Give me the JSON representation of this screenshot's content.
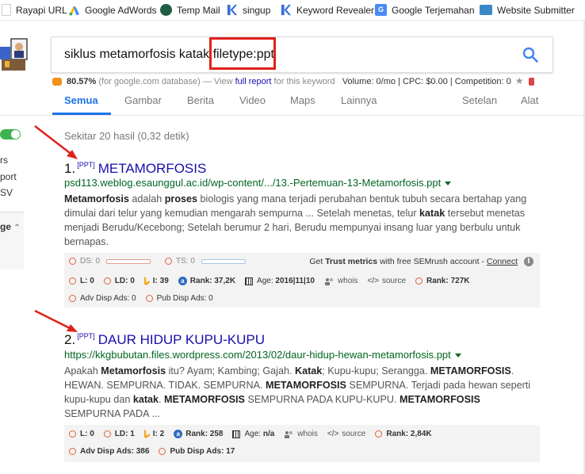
{
  "bookmarks": [
    {
      "label": "Rayapi URL",
      "icon": "rayapi-icon",
      "color": "#ffffff"
    },
    {
      "label": "Google AdWords",
      "icon": "adwords-icon",
      "color": "#4285f4"
    },
    {
      "label": "Temp Mail",
      "icon": "tempmail-icon",
      "color": "#1f5e45"
    },
    {
      "label": "singup",
      "icon": "kw-icon",
      "color": "#3a6fd8"
    },
    {
      "label": "Keyword Revealer",
      "icon": "kw-revealer-icon",
      "color": "#3a6fd8"
    },
    {
      "label": "Google Terjemahan",
      "icon": "translate-icon",
      "color": "#4a8af4"
    },
    {
      "label": "Website Submitter",
      "icon": "im-icon",
      "color": "#3b87c8"
    }
  ],
  "search": {
    "query_main": "siklus metamorfosis katak ",
    "query_operator": "filetype:ppt",
    "highlight_color": "#e0211b"
  },
  "seo_bar": {
    "percent": "80.57%",
    "db_note": "(for google.com database) —",
    "view_text": "View",
    "full_report": "full report",
    "for_keyword": "for this keyword",
    "volume": "Volume: 0/mo | CPC: $0.00 | Competition: 0"
  },
  "tabs": [
    {
      "label": "Semua",
      "active": true
    },
    {
      "label": "Gambar"
    },
    {
      "label": "Berita"
    },
    {
      "label": "Video"
    },
    {
      "label": "Maps"
    },
    {
      "label": "Lainnya"
    },
    {
      "label": "Setelan"
    },
    {
      "label": "Alat"
    }
  ],
  "sidebar": {
    "frag1": "rs",
    "frag2": "port",
    "frag3": "SV",
    "frag4": "ge",
    "toggle_color": "#3eb34f"
  },
  "results_stats": "Sekitar 20 hasil (0,32 detik)",
  "results": [
    {
      "num": "1.",
      "badge": "[PPT]",
      "title": "METAMORFOSIS",
      "url": "psd113.weblog.esaunggul.ac.id/wp-content/.../13.-Pertemuan-13-Metamorfosis.ppt",
      "snippet": [
        {
          "b": "Metamorfosis"
        },
        {
          "t": " adalah "
        },
        {
          "b": "proses"
        },
        {
          "t": " biologis yang mana terjadi perubahan bentuk tubuh secara bertahap yang dimulai dari telur yang kemudian mengarah sempurna ... Setelah menetas, telur "
        },
        {
          "b": "katak"
        },
        {
          "t": " tersebut menetas menjadi Berudu/Kecebong; Setelah berumur 2 hari, Berudu mempunyai insang luar yang berbulu untuk bernapas."
        }
      ],
      "metrics": {
        "ds": "DS: 0",
        "ts": "TS: 0",
        "trust_pre": "Get",
        "trust_bold": "Trust metrics",
        "trust_post": "with free SEMrush account -",
        "connect": "Connect",
        "l": "L: 0",
        "ld": "LD: 0",
        "i": "I: 39",
        "rank": "Rank: 37,2K",
        "age_label": "Age:",
        "age": "2016|11|10",
        "whois": "whois",
        "source": "source",
        "rank2": "Rank: 727K",
        "adv": "Adv Disp Ads: 0",
        "pub": "Pub Disp Ads: 0"
      }
    },
    {
      "num": "2.",
      "badge": "[PPT]",
      "title": "DAUR HIDUP KUPU-KUPU",
      "url": "https://kkgbubutan.files.wordpress.com/2013/02/daur-hidup-hewan-metamorfosis.ppt",
      "snippet": [
        {
          "t": "Apakah "
        },
        {
          "b": "Metamorfosis"
        },
        {
          "t": " itu? Ayam; Kambing; Gajah. "
        },
        {
          "b": "Katak"
        },
        {
          "t": "; Kupu-kupu; Serangga. "
        },
        {
          "b": "METAMORFOSIS"
        },
        {
          "t": ". HEWAN. SEMPURNA. TIDAK. SEMPURNA. "
        },
        {
          "b": "METAMORFOSIS"
        },
        {
          "t": " SEMPURNA. Terjadi pada hewan seperti kupu-kupu dan "
        },
        {
          "b": "katak"
        },
        {
          "t": ". "
        },
        {
          "b": "METAMORFOSIS"
        },
        {
          "t": " SEMPURNA PADA KUPU-KUPU. "
        },
        {
          "b": "METAMORFOSIS"
        },
        {
          "t": " SEMPURNA PADA ..."
        }
      ],
      "metrics": {
        "l": "L: 0",
        "ld": "LD: 1",
        "i": "I: 2",
        "rank": "Rank: 258",
        "age_label": "Age:",
        "age": "n/a",
        "whois": "whois",
        "source": "source",
        "rank2": "Rank: 2,84K",
        "adv": "Adv Disp Ads: 386",
        "pub": "Pub Disp Ads: 17"
      }
    }
  ],
  "colors": {
    "link": "#1a0dab",
    "url": "#006621",
    "arrow": "#e0211b",
    "tab_active": "#1a73e8"
  }
}
